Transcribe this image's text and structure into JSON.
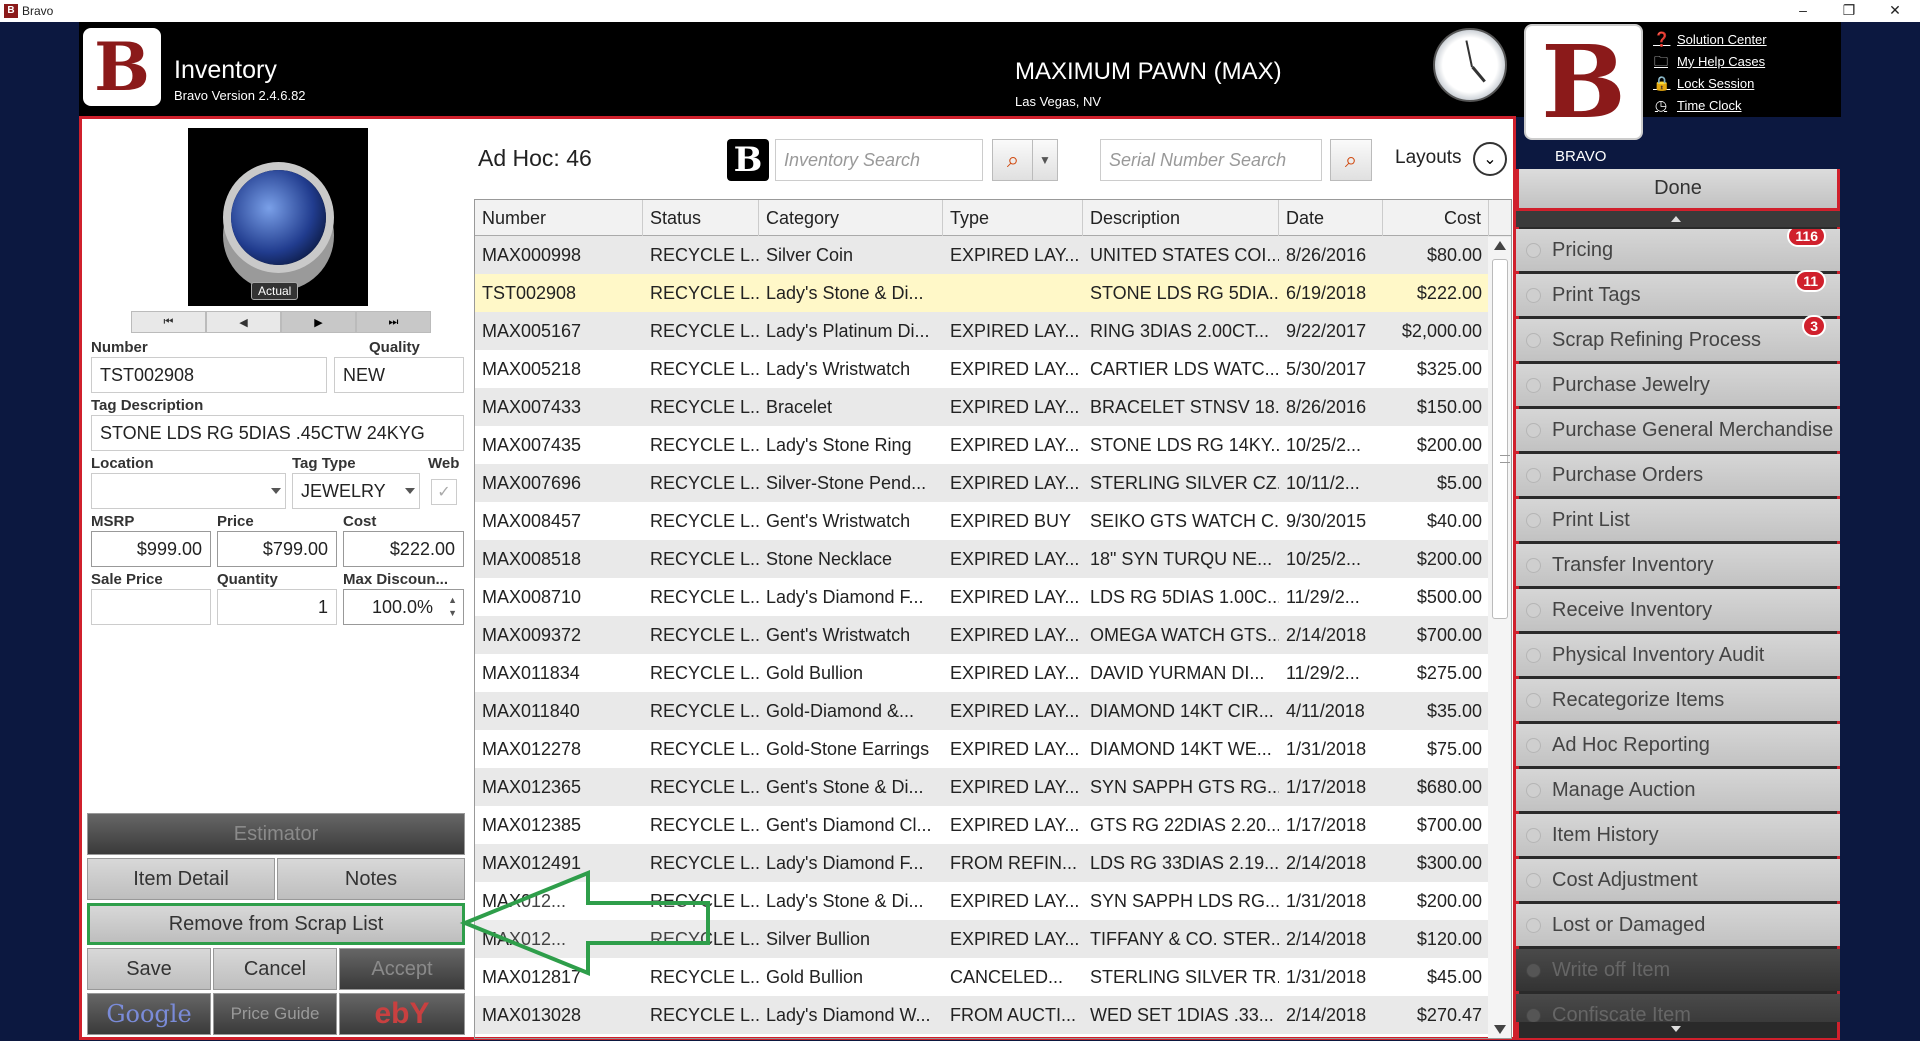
{
  "window": {
    "title": "Bravo",
    "app_icon": "bravo-logo-icon"
  },
  "header": {
    "module": "Inventory",
    "version": "Bravo Version 2.4.6.82",
    "store": "MAXIMUM PAWN (MAX)",
    "city": "Las Vegas, NV",
    "bravo_label": "BRAVO",
    "help_links": [
      "Solution Center",
      "My Help Cases",
      "Lock Session",
      "Time Clock"
    ]
  },
  "item": {
    "photo_label": "Actual",
    "labels": {
      "number": "Number",
      "quality": "Quality",
      "tag_description": "Tag Description",
      "location": "Location",
      "tag_type": "Tag Type",
      "web": "Web",
      "msrp": "MSRP",
      "price": "Price",
      "cost": "Cost",
      "sale_price": "Sale Price",
      "quantity": "Quantity",
      "max_discount": "Max Discoun..."
    },
    "number": "TST002908",
    "quality": "NEW",
    "tag_description": "STONE LDS RG 5DIAS .45CTW 24KYG",
    "location": "",
    "tag_type": "JEWELRY",
    "web_checked": true,
    "msrp": "$999.00",
    "price": "$799.00",
    "cost": "$222.00",
    "sale_price": "",
    "quantity": "1",
    "max_discount": "100.0%"
  },
  "buttons": {
    "estimator": "Estimator",
    "item_detail": "Item Detail",
    "notes": "Notes",
    "remove_scrap": "Remove from Scrap List",
    "save": "Save",
    "cancel": "Cancel",
    "accept": "Accept",
    "google": "Google",
    "price_guide": "Price Guide",
    "ebay": "ebY"
  },
  "search": {
    "adhoc": "Ad Hoc: 46",
    "inventory_placeholder": "Inventory Search",
    "serial_placeholder": "Serial Number Search",
    "layouts": "Layouts"
  },
  "grid": {
    "columns": [
      "Number",
      "Status",
      "Category",
      "Type",
      "Description",
      "Date",
      "Cost"
    ],
    "rows": [
      [
        "MAX000998",
        "RECYCLE L...",
        "Silver Coin",
        "EXPIRED LAY...",
        "UNITED STATES COI...",
        "8/26/2016",
        "$80.00"
      ],
      [
        "TST002908",
        "RECYCLE L...",
        "Lady's Stone & Di...",
        "",
        "STONE LDS RG 5DIA...",
        "6/19/2018",
        "$222.00"
      ],
      [
        "MAX005167",
        "RECYCLE L...",
        "Lady's Platinum Di...",
        "EXPIRED LAY...",
        "RING 3DIAS 2.00CT...",
        "9/22/2017",
        "$2,000.00"
      ],
      [
        "MAX005218",
        "RECYCLE L...",
        "Lady's Wristwatch",
        "EXPIRED LAY...",
        "CARTIER LDS WATC...",
        "5/30/2017",
        "$325.00"
      ],
      [
        "MAX007433",
        "RECYCLE L...",
        "Bracelet",
        "EXPIRED LAY...",
        "BRACELET STNSV 18...",
        "8/26/2016",
        "$150.00"
      ],
      [
        "MAX007435",
        "RECYCLE L...",
        "Lady's Stone Ring",
        "EXPIRED LAY...",
        "STONE LDS RG 14KY...",
        "10/25/2...",
        "$200.00"
      ],
      [
        "MAX007696",
        "RECYCLE L...",
        "Silver-Stone Pend...",
        "EXPIRED LAY...",
        "STERLING SILVER CZ...",
        "10/11/2...",
        "$5.00"
      ],
      [
        "MAX008457",
        "RECYCLE L...",
        "Gent's Wristwatch",
        "EXPIRED BUY",
        "SEIKO GTS WATCH C...",
        "9/30/2015",
        "$40.00"
      ],
      [
        "MAX008518",
        "RECYCLE L...",
        "Stone Necklace",
        "EXPIRED LAY...",
        "18\" SYN TURQU NE...",
        "10/25/2...",
        "$200.00"
      ],
      [
        "MAX008710",
        "RECYCLE L...",
        "Lady's Diamond F...",
        "EXPIRED LAY...",
        "LDS RG 5DIAS 1.00C...",
        "11/29/2...",
        "$500.00"
      ],
      [
        "MAX009372",
        "RECYCLE L...",
        "Gent's Wristwatch",
        "EXPIRED LAY...",
        "OMEGA WATCH GTS...",
        "2/14/2018",
        "$700.00"
      ],
      [
        "MAX011834",
        "RECYCLE L...",
        "Gold Bullion",
        "EXPIRED LAY...",
        "DAVID YURMAN DI...",
        "11/29/2...",
        "$275.00"
      ],
      [
        "MAX011840",
        "RECYCLE L...",
        "Gold-Diamond &...",
        "EXPIRED LAY...",
        "DIAMOND 14KT CIR...",
        "4/11/2018",
        "$35.00"
      ],
      [
        "MAX012278",
        "RECYCLE L...",
        "Gold-Stone Earrings",
        "EXPIRED LAY...",
        "DIAMOND 14KT WE...",
        "1/31/2018",
        "$75.00"
      ],
      [
        "MAX012365",
        "RECYCLE L...",
        "Gent's Stone & Di...",
        "EXPIRED LAY...",
        "SYN SAPPH GTS RG...",
        "1/17/2018",
        "$680.00"
      ],
      [
        "MAX012385",
        "RECYCLE L...",
        "Gent's Diamond Cl...",
        "EXPIRED LAY...",
        "GTS RG 22DIAS 2.20...",
        "1/17/2018",
        "$700.00"
      ],
      [
        "MAX012491",
        "RECYCLE L...",
        "Lady's Diamond F...",
        "FROM REFIN...",
        "LDS RG 33DIAS 2.19...",
        "2/14/2018",
        "$300.00"
      ],
      [
        "MAX012...",
        "RECYCLE L...",
        "Lady's Stone & Di...",
        "EXPIRED LAY...",
        "SYN SAPPH LDS RG...",
        "1/31/2018",
        "$200.00"
      ],
      [
        "MAX012...",
        "RECYCLE L...",
        "Silver Bullion",
        "EXPIRED LAY...",
        "TIFFANY & CO. STER...",
        "2/14/2018",
        "$120.00"
      ],
      [
        "MAX012817",
        "RECYCLE L...",
        "Gold Bullion",
        "CANCELED...",
        "STERLING SILVER TR...",
        "1/31/2018",
        "$45.00"
      ],
      [
        "MAX013028",
        "RECYCLE L...",
        "Lady's Diamond W...",
        "FROM AUCTI...",
        "WED SET 1DIAS .33...",
        "2/14/2018",
        "$270.47"
      ]
    ]
  },
  "sidebar": {
    "done": "Done",
    "items": [
      {
        "label": "Pricing",
        "badge": "116"
      },
      {
        "label": "Print Tags",
        "badge": "11"
      },
      {
        "label": "Scrap Refining Process",
        "badge": "3"
      },
      {
        "label": "Purchase Jewelry"
      },
      {
        "label": "Purchase General Merchandise"
      },
      {
        "label": "Purchase Orders"
      },
      {
        "label": "Print List"
      },
      {
        "label": "Transfer Inventory"
      },
      {
        "label": "Receive Inventory"
      },
      {
        "label": "Physical Inventory Audit"
      },
      {
        "label": "Recategorize Items"
      },
      {
        "label": "Ad Hoc Reporting"
      },
      {
        "label": "Manage Auction"
      },
      {
        "label": "Item History"
      },
      {
        "label": "Cost Adjustment"
      },
      {
        "label": "Lost or Damaged"
      },
      {
        "label": "Write off Item",
        "disabled": true
      },
      {
        "label": "Confiscate Item",
        "disabled": true
      }
    ]
  },
  "colors": {
    "brand_red": "#d0202c",
    "highlight_green": "#2e9e4a",
    "selected_row": "#fff8c8"
  }
}
